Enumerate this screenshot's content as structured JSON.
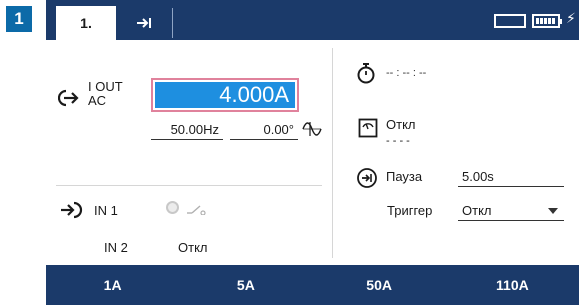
{
  "badge": "1",
  "tabs": {
    "tab1": "1.",
    "tab2_icon": "tab-arrow-icon"
  },
  "status": {
    "battery_icon": "battery-icon",
    "charge_icon": "charging-icon"
  },
  "output": {
    "label_line1": "I OUT",
    "label_line2": "AC",
    "value": "4.000A",
    "frequency": "50.00Hz",
    "phase": "0.00°"
  },
  "input": {
    "in1_label": "IN 1",
    "in2_label": "IN 2",
    "in2_value": "Откл"
  },
  "right": {
    "timer": "-- : -- : --",
    "mode_label": "Откл",
    "mode_sub": "- - - -",
    "pause_label": "Пауза",
    "pause_value": "5.00s",
    "trigger_label": "Триггер",
    "trigger_value": "Откл"
  },
  "presets": [
    "1A",
    "5A",
    "50A",
    "110A"
  ],
  "colors": {
    "nav": "#1b3a6a",
    "accent": "#1e8fe0",
    "badge": "#0c6aa8",
    "highlight_border": "#e0829c"
  }
}
